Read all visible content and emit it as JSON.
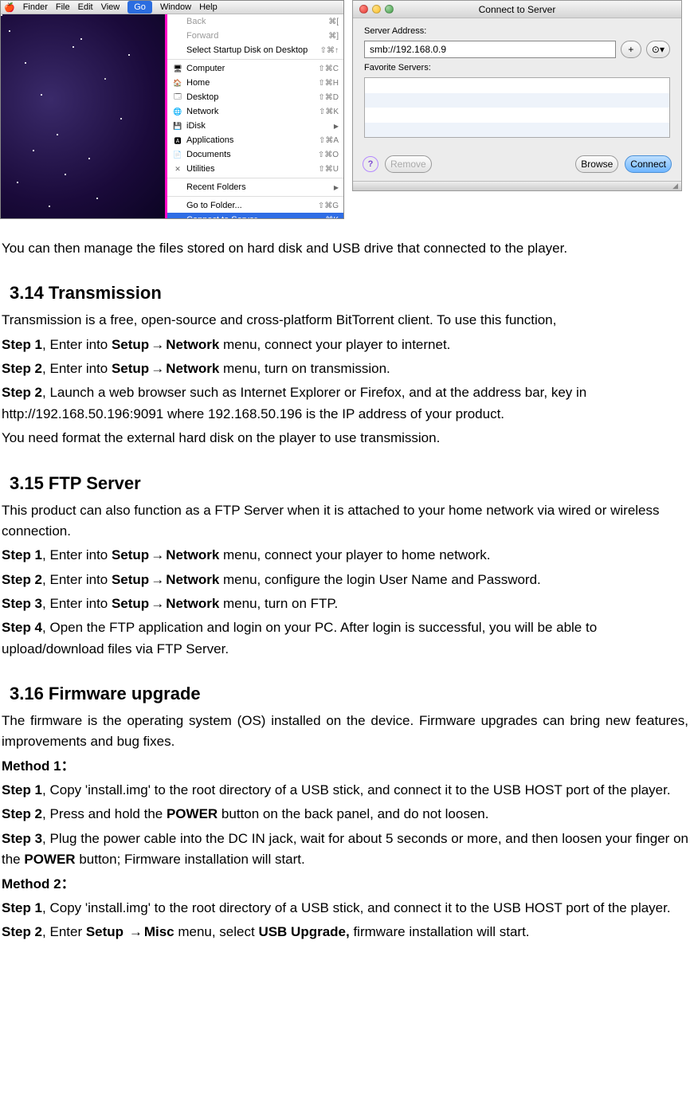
{
  "mac": {
    "menubar": {
      "items": [
        "Finder",
        "File",
        "Edit",
        "View",
        "Go",
        "Window",
        "Help"
      ]
    },
    "go_menu": {
      "back": "Back",
      "back_sc": "⌘[",
      "forward": "Forward",
      "forward_sc": "⌘]",
      "startup": "Select Startup Disk on Desktop",
      "startup_sc": "⇧⌘↑",
      "computer": "Computer",
      "computer_sc": "⇧⌘C",
      "home": "Home",
      "home_sc": "⇧⌘H",
      "desktop": "Desktop",
      "desktop_sc": "⇧⌘D",
      "network": "Network",
      "network_sc": "⇧⌘K",
      "idisk": "iDisk",
      "applications": "Applications",
      "applications_sc": "⇧⌘A",
      "documents": "Documents",
      "documents_sc": "⇧⌘O",
      "utilities": "Utilities",
      "utilities_sc": "⇧⌘U",
      "recent": "Recent Folders",
      "goto": "Go to Folder...",
      "goto_sc": "⇧⌘G",
      "connect": "Connect to Server...",
      "connect_sc": "⌘K"
    }
  },
  "cts": {
    "title": "Connect to Server",
    "addr_label": "Server Address:",
    "addr_value": "smb://192.168.0.9",
    "fav_label": "Favorite Servers:",
    "plus": "+",
    "history": "⊙▾",
    "remove": "Remove",
    "browse": "Browse",
    "connect": "Connect",
    "help": "?"
  },
  "doc": {
    "manage_line": "You can then manage the files stored on hard disk and USB drive that connected to the player.",
    "h_transmission": "3.14 Transmission",
    "trans_intro": "Transmission is a free, open-source and cross-platform BitTorrent client. To use this function,",
    "s1": "Step 1",
    "s1t": ", Enter into ",
    "setup": "Setup",
    "network": "Network",
    "menu_txt": " menu, ",
    "t_step1_rest": "connect your player to internet.",
    "s2": "Step 2",
    "t_step2_rest": "turn on transmission.",
    "t_step3": ", Launch a web browser such as Internet Explorer or Firefox, and at the address bar, key in http://192.168.50.196:9091 where 192.168.50.196 is the IP address of your product.",
    "t_note": "You need format the external hard disk on the player to use transmission.",
    "h_ftp": "3.15 FTP Server",
    "ftp_intro": "This product can also function as a FTP Server when it is attached to your home network via wired or wireless connection.",
    "f_step1_rest": "connect your player to home network.",
    "f_step2_rest": "configure the login User Name and Password.",
    "s3": "Step 3",
    "f_step3_rest": "turn on FTP.",
    "s4": "Step 4",
    "f_step4": ", Open the FTP application and login on your PC. After login is successful, you will be able to upload/download files via FTP Server.",
    "h_fw": "3.16 Firmware upgrade",
    "fw_intro": "The firmware is the operating system (OS) installed on the device. Firmware upgrades can bring new features, improvements and bug fixes.",
    "m1": "Method 1：",
    "fw_m1_s1": ", Copy 'install.img' to the root directory of a USB stick, and connect it to the USB HOST port of the player.",
    "fw_m1_s2a": ", Press and hold the ",
    "power": "POWER",
    "fw_m1_s2b": " button on the back panel, and do not loosen.",
    "fw_m1_s3a": ", Plug the power cable into the DC IN jack, wait for about 5 seconds or more, and then loosen your finger on the ",
    "fw_m1_s3b": " button; Firmware installation will start.",
    "m2": "Method 2：",
    "fw_m2_s1": ", Copy 'install.img' to the root directory of a USB stick, and connect it to the USB HOST port of the player.",
    "fw_m2_s2a": ", Enter ",
    "misc": "Misc",
    "fw_m2_s2b": " menu, select ",
    "usb_upgrade": "USB Upgrade,",
    "fw_m2_s2c": " firmware installation will start."
  }
}
